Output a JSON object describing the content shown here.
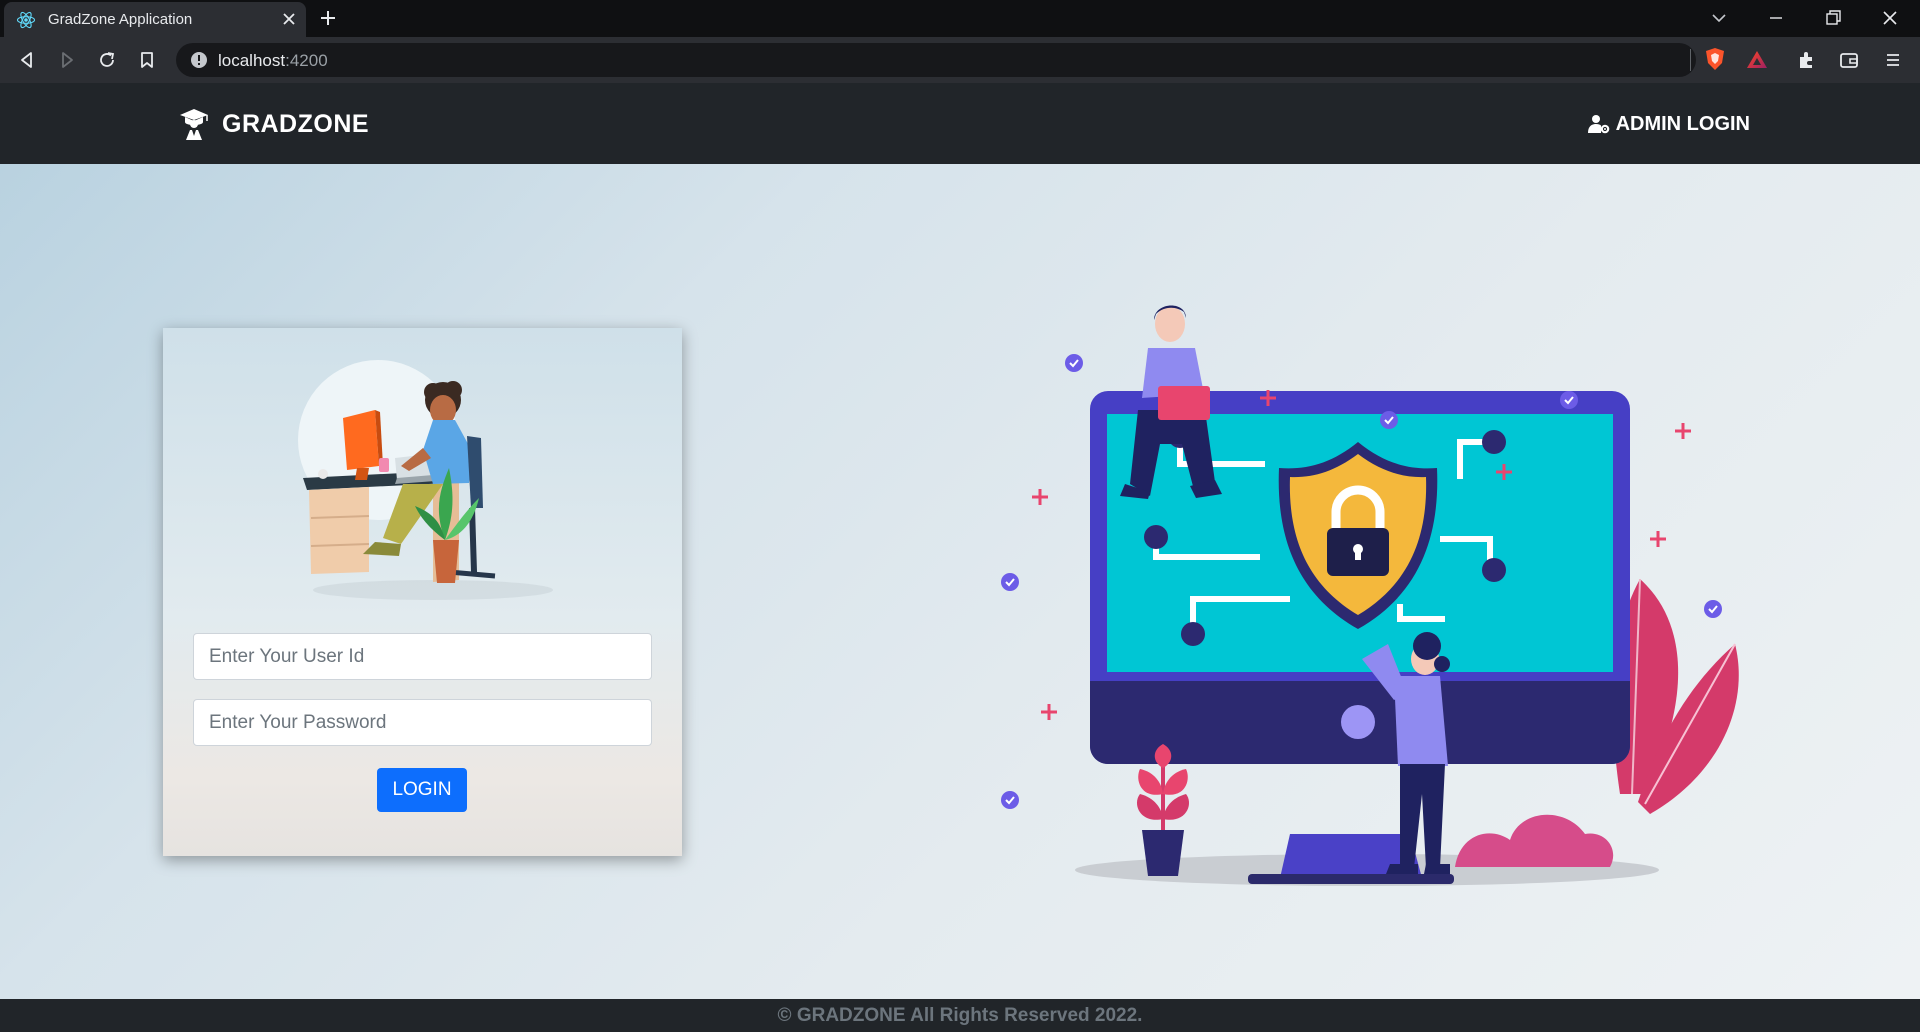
{
  "browser": {
    "tab_title": "GradZone Application",
    "url_host": "localhost",
    "url_port": ":4200",
    "icons": [
      "react-icon",
      "close-icon",
      "plus-icon",
      "chevron-down-icon",
      "minimize-icon",
      "restore-icon",
      "close-window-icon",
      "back-icon",
      "forward-icon",
      "reload-icon",
      "bookmark-icon",
      "info-icon",
      "brave-shield-icon",
      "brave-rewards-icon",
      "extensions-icon",
      "wallet-icon",
      "menu-icon"
    ]
  },
  "navbar": {
    "brand": "GRADZONE",
    "admin_login": "ADMIN LOGIN"
  },
  "login_form": {
    "user_id_placeholder": "Enter Your User Id",
    "password_placeholder": "Enter Your Password",
    "login_label": "LOGIN"
  },
  "footer": {
    "text": "© GRADZONE All Rights Reserved 2022."
  },
  "colors": {
    "navbar_bg": "#212529",
    "primary_button": "#0d6efd",
    "monitor_screen": "#00c8d6",
    "monitor_frame": "#463fc5",
    "shield": "#f4b83c",
    "accent_pink": "#e0456e",
    "check_purple": "#6c5ce7"
  }
}
